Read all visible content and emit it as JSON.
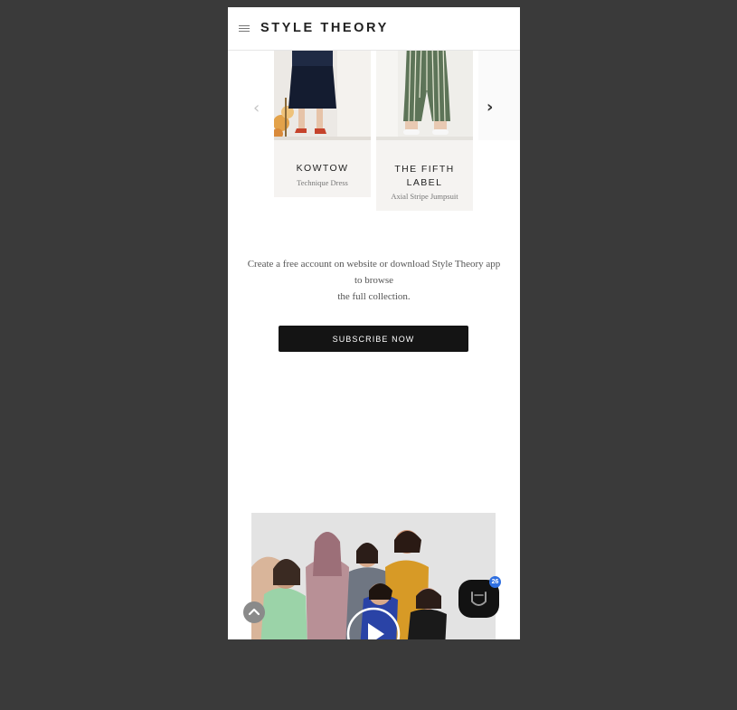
{
  "header": {
    "logo": "STYLE THEORY",
    "menu_icon": "hamburger-icon"
  },
  "carousel": {
    "prev_icon": "chevron-left-icon",
    "next_icon": "chevron-right-icon",
    "prev_glyph": "‹",
    "next_glyph": "›",
    "items": [
      {
        "brand": "KOWTOW",
        "product": "Technique Dress"
      },
      {
        "brand": "THE FIFTH LABEL",
        "product": "Axial Stripe Jumpsuit"
      }
    ]
  },
  "cta": {
    "text_line1": "Create a free account on website or download Style Theory app to browse",
    "text_line2": "the full collection.",
    "button_label": "SUBSCRIBE NOW"
  },
  "video": {
    "play_icon": "play-icon"
  },
  "widgets": {
    "scroll_top_icon": "chevron-up-icon",
    "chat_icon": "chat-smile-icon",
    "chat_badge": "26"
  },
  "colors": {
    "background": "#3a3a3a",
    "page": "#ffffff",
    "button": "#141414",
    "badge": "#2f6fe0"
  }
}
